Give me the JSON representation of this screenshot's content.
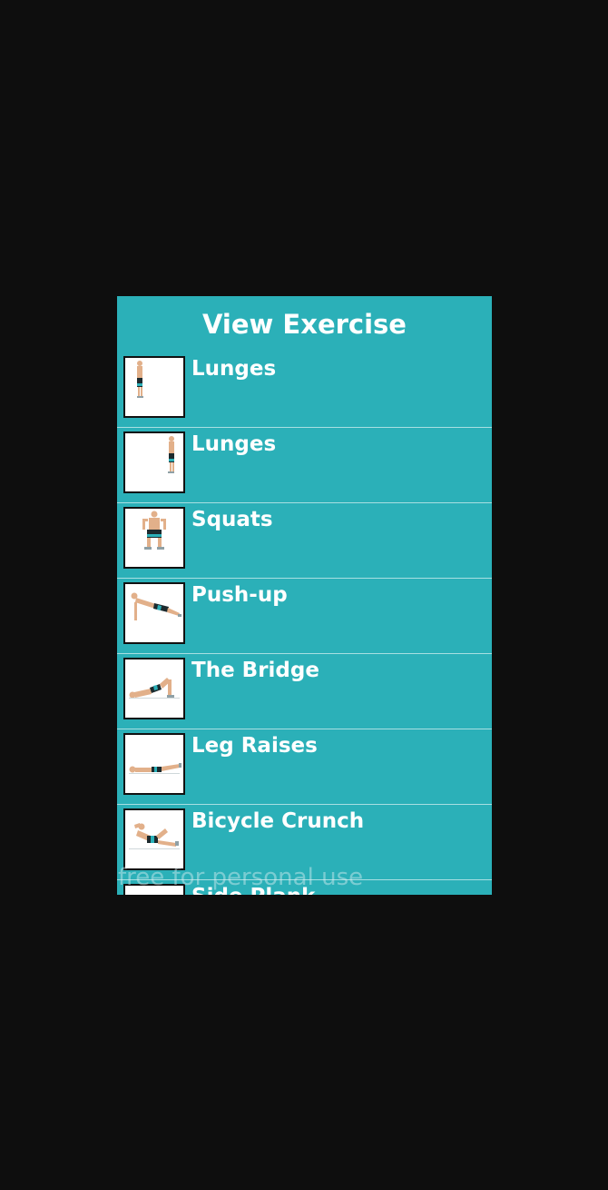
{
  "dialog": {
    "title": "View Exercise",
    "background_color": "#2bb0b8",
    "items": [
      {
        "label": "Lunges",
        "icon": "lunges-standing-icon"
      },
      {
        "label": "Lunges",
        "icon": "lunges-standing-side-icon"
      },
      {
        "label": "Squats",
        "icon": "squats-icon"
      },
      {
        "label": "Push-up",
        "icon": "push-up-icon"
      },
      {
        "label": "The Bridge",
        "icon": "bridge-icon"
      },
      {
        "label": "Leg Raises",
        "icon": "leg-raises-icon"
      },
      {
        "label": "Bicycle Crunch",
        "icon": "bicycle-crunch-icon"
      },
      {
        "label": "Side Plank",
        "icon": "side-plank-icon"
      }
    ]
  },
  "watermark": "free for personal use"
}
